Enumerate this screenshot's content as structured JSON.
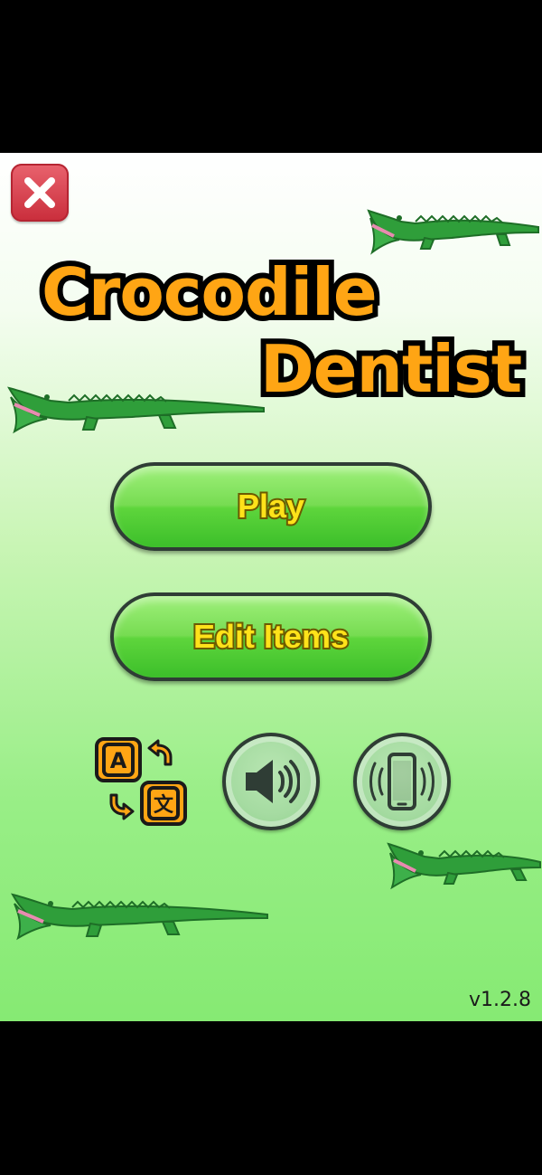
{
  "game": {
    "title_line1": "Crocodile",
    "title_line2": "Dentist",
    "version": "v1.2.8"
  },
  "menu": {
    "play_label": "Play",
    "edit_items_label": "Edit Items"
  },
  "icons": {
    "close": "close-icon",
    "language": "language-switch-icon",
    "sound": "speaker-icon",
    "vibration": "vibration-phone-icon",
    "decor": "crocodile-icon"
  },
  "colors": {
    "title_fill": "#ffa514",
    "button_green": "#5ed53c",
    "button_text": "#ffe21a",
    "close_red": "#d83a48",
    "crocodile_green": "#2f9e3a"
  }
}
